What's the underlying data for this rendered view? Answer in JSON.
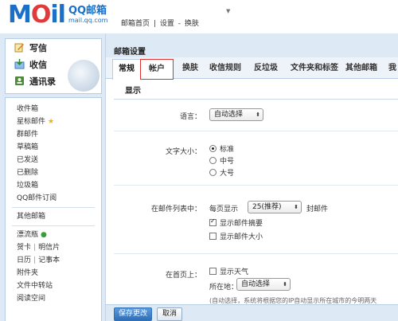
{
  "header": {
    "logo_text": "MOil",
    "logo_qq": "QQ邮箱",
    "logo_domain": "mail.qq.com",
    "links": [
      "邮箱首页",
      "|",
      "设置",
      "-",
      "换肤"
    ]
  },
  "sidebar": {
    "actions": [
      {
        "label": "写信",
        "icon": "pencil-icon"
      },
      {
        "label": "收信",
        "icon": "inbox-icon"
      },
      {
        "label": "通讯录",
        "icon": "contacts-icon"
      }
    ],
    "folders_main": [
      "收件箱",
      "星标邮件",
      "群邮件",
      "草稿箱",
      "已发送",
      "已删除",
      "垃圾箱",
      "QQ邮件订阅"
    ],
    "folders_other": [
      "其他邮箱"
    ],
    "apps": {
      "drift": "漂流瓶",
      "card": "贺卡",
      "postcard": "明信片",
      "calendar": "日历",
      "notes": "记事本",
      "attachments": "附件夹",
      "transfer": "文件中转站",
      "reading": "阅读空间",
      "sep": "|"
    }
  },
  "main": {
    "title": "邮箱设置",
    "tabs": [
      "常规",
      "帐户",
      "换肤",
      "收信规则",
      "反垃圾",
      "文件夹和标签",
      "其他邮箱",
      "我"
    ],
    "section": "显示",
    "language": {
      "label": "语言：",
      "value": "自动选择"
    },
    "font_size": {
      "label": "文字大小：",
      "options": [
        "标准",
        "中号",
        "大号"
      ]
    },
    "mail_list": {
      "label": "在邮件列表中：",
      "per_page_prefix": "每页显示",
      "per_page_value": "25(推荐)",
      "per_page_suffix": "封邮件",
      "show_summary": "显示邮件摘要",
      "show_size": "显示邮件大小"
    },
    "homepage": {
      "label": "在首页上：",
      "show_weather": "显示天气",
      "location_label": "所在地：",
      "location_value": "自动选择",
      "note": "(自动选择，系统将根据您的IP自动显示所在城市的今明两天"
    },
    "buttons": {
      "save": "保存更改",
      "cancel": "取消"
    }
  },
  "colors": {
    "accent": "#1a6fc8",
    "highlight_border": "#e03030",
    "panel_bg": "#dde9f5"
  }
}
